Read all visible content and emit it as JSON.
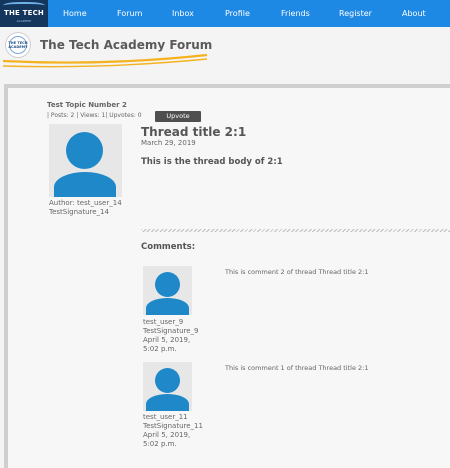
{
  "nav": {
    "logo_text": "THE TECH",
    "logo_subtext": "ACADEMY",
    "items": [
      {
        "label": "Home"
      },
      {
        "label": "Forum"
      },
      {
        "label": "Inbox"
      },
      {
        "label": "Profile"
      },
      {
        "label": "Friends"
      },
      {
        "label": "Register"
      },
      {
        "label": "About"
      }
    ]
  },
  "header": {
    "icon_text": "THE TECH ACADEMY",
    "site_title": "The Tech Academy Forum",
    "accent_color": "#f5b21e"
  },
  "topic": {
    "title": "Test Topic Number 2",
    "stats": "| Posts: 2 | Views: 1| Upvotes: 0",
    "upvote_label": "Upvote"
  },
  "thread": {
    "author": "Author: test_user_14",
    "signature": "TestSignature_14",
    "title": "Thread title 2:1",
    "date": "March 29, 2019",
    "body": "This is the thread body of 2:1"
  },
  "comments_heading": "Comments:",
  "comments": [
    {
      "text": "This is comment 2 of thread Thread title 2:1",
      "user": "test_user_9",
      "signature": "TestSignature_9",
      "date_line1": "April 5, 2019,",
      "date_line2": "5:02 p.m."
    },
    {
      "text": "This is comment 1 of thread Thread title 2:1",
      "user": "test_user_11",
      "signature": "TestSignature_11",
      "date_line1": "April 5, 2019,",
      "date_line2": "5:02 p.m."
    }
  ],
  "colors": {
    "nav_bg": "#1e88e5",
    "logo_bg": "#15365c",
    "avatar_blue": "#1e88c8",
    "upvote_bg": "#4f4f4f"
  }
}
